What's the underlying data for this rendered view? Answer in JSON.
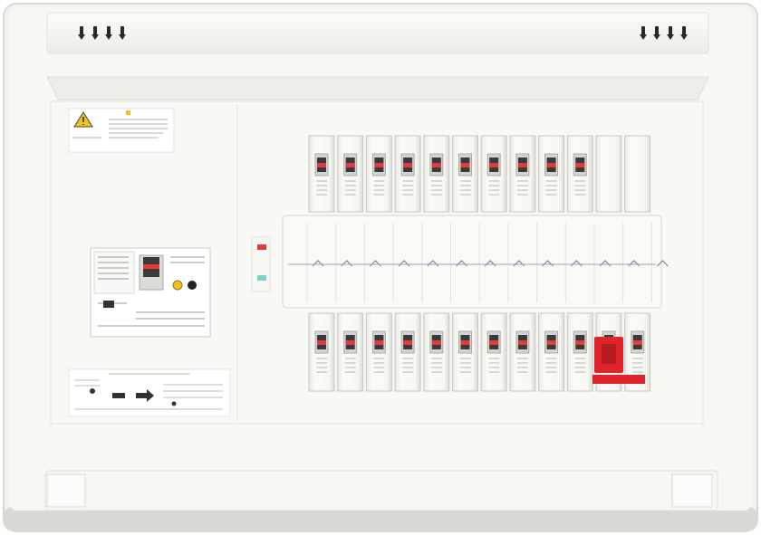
{
  "scene": {
    "subject": "residential-distribution-board",
    "colors": {
      "body": "#f4f4f1",
      "body_shadow": "#dcdcd6",
      "breaker": "#f7f7f4",
      "breaker_edge": "#c9c9c2",
      "handle_red": "#e23b3b",
      "handle_dark": "#3a3a3a",
      "accent_red": "#e0242c",
      "warning_yellow": "#f2c21b",
      "indicator_green": "#7fd1c3"
    },
    "icons": [
      "warning-triangle-icon",
      "vent-slot-icon",
      "arrow-right-icon"
    ]
  },
  "status": {
    "top_breaker_count": 12,
    "bottom_breaker_count": 12,
    "top_active_handles": 10,
    "bottom_active_handles": 12
  }
}
